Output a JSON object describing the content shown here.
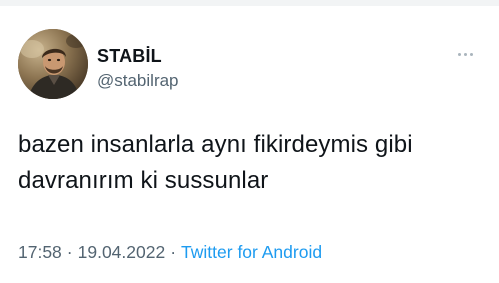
{
  "author": {
    "display_name": "STABİL",
    "handle": "@stabilrap"
  },
  "tweet": {
    "text": "bazen insanlarla aynı fikirdeymis gibi\ndavranırım ki sussunlar"
  },
  "meta": {
    "time": "17:58",
    "separator": "·",
    "date": "19.04.2022",
    "source": "Twitter for Android"
  },
  "icons": {
    "more": "more-horizontal-icon"
  },
  "colors": {
    "text": "#0f1419",
    "secondary": "#536471",
    "link": "#1d9bf0"
  }
}
